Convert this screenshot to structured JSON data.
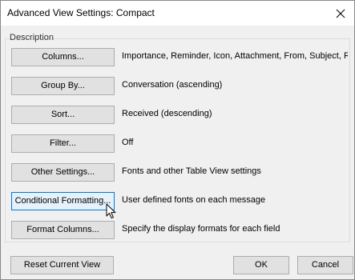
{
  "window": {
    "title": "Advanced View Settings: Compact",
    "close_icon": "close-icon"
  },
  "section": {
    "label": "Description"
  },
  "rows": [
    {
      "button": "Columns...",
      "description": "Importance, Reminder, Icon, Attachment, From, Subject, Re..."
    },
    {
      "button": "Group By...",
      "description": "Conversation (ascending)"
    },
    {
      "button": "Sort...",
      "description": "Received (descending)"
    },
    {
      "button": "Filter...",
      "description": "Off"
    },
    {
      "button": "Other Settings...",
      "description": "Fonts and other Table View settings"
    },
    {
      "button": "Conditional Formatting...",
      "description": "User defined fonts on each message"
    },
    {
      "button": "Format Columns...",
      "description": "Specify the display formats for each field"
    }
  ],
  "footer": {
    "reset_label": "Reset Current View",
    "ok_label": "OK",
    "cancel_label": "Cancel"
  },
  "colors": {
    "focus_border": "#0078d7",
    "button_face": "#e1e1e1",
    "dialog_bg": "#f0f0f0"
  }
}
